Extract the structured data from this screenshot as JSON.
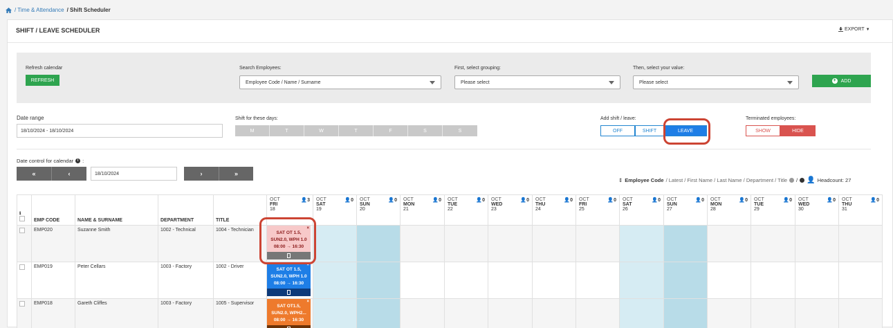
{
  "breadcrumb": {
    "home_icon": "home-icon",
    "parent": "/ Time & Attendance",
    "current": "/ Shift Scheduler"
  },
  "header": {
    "title": "SHIFT / LEAVE SCHEDULER",
    "export_label": "EXPORT"
  },
  "filters": {
    "refresh_label": "Refresh calendar",
    "refresh_button": "REFRESH",
    "search_label": "Search Employees:",
    "search_value": "Employee Code / Name / Surname",
    "grouping_label": "First, select grouping:",
    "grouping_value": "Please select",
    "value_label": "Then, select your value:",
    "value_value": "Please select",
    "add_button": "ADD"
  },
  "options": {
    "date_range_label": "Date range",
    "date_range_value": "18/10/2024 - 18/10/2024",
    "shift_days_label": "Shift for these days:",
    "days": [
      "M",
      "T",
      "W",
      "T",
      "F",
      "S",
      "S"
    ],
    "add_shift_label": "Add shift / leave:",
    "add_shift_options": [
      "OFF",
      "SHIFT",
      "LEAVE"
    ],
    "add_shift_selected": "LEAVE",
    "terminated_label": "Terminated employees:",
    "terminated_options": [
      "SHOW",
      "HIDE"
    ],
    "terminated_selected": "HIDE"
  },
  "date_control": {
    "label": "Date control for calendar",
    "date_value": "18/10/2024",
    "first": "«",
    "prev": "‹",
    "next": "›",
    "last": "»"
  },
  "sort": {
    "active": "Employee Code",
    "others": "/ Latest / First Name / Last Name / Department / Title",
    "headcount_label": "Headcount: 27"
  },
  "table": {
    "columns": [
      "EMP CODE",
      "NAME & SURNAME",
      "DEPARTMENT",
      "TITLE"
    ],
    "days": [
      {
        "mon": "OCT",
        "dw": "FRI",
        "d": "18",
        "hc": "3"
      },
      {
        "mon": "OCT",
        "dw": "SAT",
        "d": "19",
        "hc": "0"
      },
      {
        "mon": "OCT",
        "dw": "SUN",
        "d": "20",
        "hc": "0"
      },
      {
        "mon": "OCT",
        "dw": "MON",
        "d": "21",
        "hc": "0"
      },
      {
        "mon": "OCT",
        "dw": "TUE",
        "d": "22",
        "hc": "0"
      },
      {
        "mon": "OCT",
        "dw": "WED",
        "d": "23",
        "hc": "0"
      },
      {
        "mon": "OCT",
        "dw": "THU",
        "d": "24",
        "hc": "0"
      },
      {
        "mon": "OCT",
        "dw": "FRI",
        "d": "25",
        "hc": "0"
      },
      {
        "mon": "OCT",
        "dw": "SAT",
        "d": "26",
        "hc": "0"
      },
      {
        "mon": "OCT",
        "dw": "SUN",
        "d": "27",
        "hc": "0"
      },
      {
        "mon": "OCT",
        "dw": "MON",
        "d": "28",
        "hc": "0"
      },
      {
        "mon": "OCT",
        "dw": "TUE",
        "d": "29",
        "hc": "0"
      },
      {
        "mon": "OCT",
        "dw": "WED",
        "d": "30",
        "hc": "0"
      },
      {
        "mon": "OCT",
        "dw": "THU",
        "d": "31",
        "hc": "0"
      }
    ],
    "rows": [
      {
        "code": "EMP020",
        "name": "Suzanne Smith",
        "dept": "1002 - Technical",
        "title": "1004 - Technician",
        "card": {
          "l1": "SAT OT 1.5,",
          "l2": "SUN2.0, WPH 1.0",
          "l3": "08:00 → 16:30",
          "color": "#f7c9c9",
          "text": "#8b1a1a",
          "foot": "#777777"
        }
      },
      {
        "code": "EMP019",
        "name": "Peter Cellars",
        "dept": "1003 - Factory",
        "title": "1002 - Driver",
        "card": {
          "l1": "SAT OT 1.5,",
          "l2": "SUN2.0, WPH 1.0",
          "l3": "08:00 → 16:30",
          "color": "#1e7ee6",
          "text": "#ffffff",
          "foot": "#0d3a7a"
        }
      },
      {
        "code": "EMP018",
        "name": "Gareth Cliffes",
        "dept": "1003 - Factory",
        "title": "1005 - Supervisor",
        "card": {
          "l1": "SAT OT1.5,",
          "l2": "SUN2.0, WPH2...",
          "l3": "08:00 → 16:30",
          "color": "#ee7a2c",
          "text": "#ffffff",
          "foot": "#6b3208"
        }
      }
    ]
  }
}
